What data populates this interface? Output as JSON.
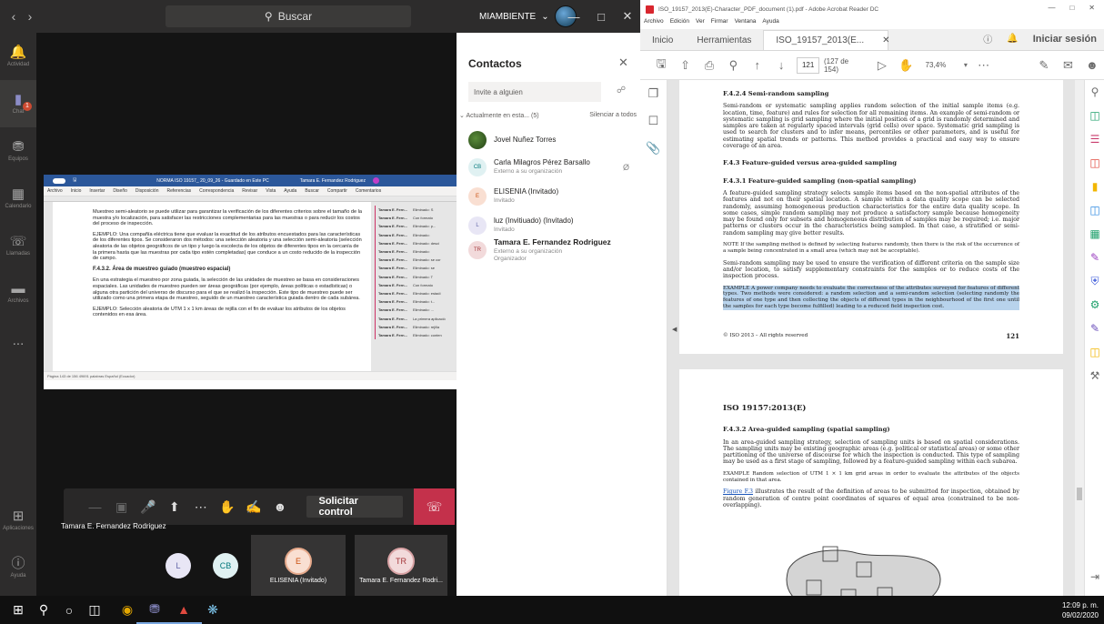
{
  "teams": {
    "search_placeholder": "Buscar",
    "user_label": "MIAMBIENTE",
    "rail": [
      {
        "label": "Actividad",
        "icon": "bell-icon"
      },
      {
        "label": "Chat",
        "icon": "chat-icon",
        "badge": "1"
      },
      {
        "label": "Equipos",
        "icon": "teams-icon"
      },
      {
        "label": "Calendario",
        "icon": "calendar-icon"
      },
      {
        "label": "Llamadas",
        "icon": "phone-icon"
      },
      {
        "label": "Archivos",
        "icon": "files-icon"
      },
      {
        "label": "...",
        "icon": "more-icon"
      }
    ],
    "rail_bottom": [
      {
        "label": "Aplicaciones",
        "icon": "apps-icon"
      },
      {
        "label": "Ayuda",
        "icon": "help-icon"
      }
    ],
    "word": {
      "title": "NORMA ISO 19157_ 20_09_26 - Guardado en Este PC",
      "user": "Tamara E. Fernandez Rodriguez",
      "menu": [
        "Archivo",
        "Inicio",
        "Insertar",
        "Diseño",
        "Disposición",
        "Referencias",
        "Correspondencia",
        "Revisar",
        "Vista",
        "Ayuda",
        "Buscar",
        "Compartir",
        "Comentarios"
      ],
      "paragraphs": [
        "Muestreo semi-aleatorio se puede utilizar para garantizar la verificación de los diferentes criterios sobre el tamaño de la muestra y/o localización, para satisfacer las restricciones complementarias para las muestras o para reducir los costos del proceso de inspección.",
        "EJEMPLO: Una compañía eléctrica tiene que evaluar la exactitud de los atributos encuestados para las características de los diferentes tipos. Se consideraron dos métodos: una selección aleatoria y una selección semi-aleatoria (selección aleatoria de las objetos geográficos de un tipo y luego la escolecta de los objetos de diferentes tipos en la cercanía de la primera hasta que las muestras por cada tipo estén completadas) que conduce a un costo reducido de la inspección de campo."
      ],
      "heading": "F.4.3.2. Área de muestreo guiado (muestreo espacial)",
      "paragraphs2": [
        "En una estrategia el muestreo por zona guiada, la selección de las unidades de muestreo se basa en consideraciones espaciales. Las unidades de muestreo pueden ser áreas geográficas (por ejemplo, áreas políticas o estadísticas) o alguna otra partición del universo de discurso para el que se realizó la inspección. Este tipo de muestreo puede ser utilizado como una primera etapa de muestreo, seguido de un muestreo característica guiada dentro de cada subárea.",
        "EJEMPLO: Selección aleatoria de UTM 1 x 1 km áreas de rejilla con el fin de evaluar los atributos de los objetos contenidos en esa área."
      ],
      "comments": [
        {
          "who": "Tamara E. Fern...",
          "what": "Eliminado: S"
        },
        {
          "who": "Tamara E. Fern...",
          "what": "Con formato"
        },
        {
          "who": "Tamara E. Fern...",
          "what": "Eliminado: p..."
        },
        {
          "who": "Tamara E. Fern...",
          "what": "Eliminado:"
        },
        {
          "who": "Tamara E. Fern...",
          "what": "Eliminado: desci"
        },
        {
          "who": "Tamara E. Fern...",
          "what": "Eliminado:"
        },
        {
          "who": "Tamara E. Fern...",
          "what": "Eliminado: se cor"
        },
        {
          "who": "Tamara E. Fern...",
          "what": "Eliminado: se"
        },
        {
          "who": "Tamara E. Fern...",
          "what": "Eliminado: T"
        },
        {
          "who": "Tamara E. Fern...",
          "what": "Con formato"
        },
        {
          "who": "Tamara E. Fern...",
          "what": "Eliminado: estadí"
        },
        {
          "who": "Tamara E. Fern...",
          "what": "Eliminado: t..."
        },
        {
          "who": "Tamara E. Fern...",
          "what": "Eliminado: ..."
        },
        {
          "who": "Tamara E. Fern...",
          "what": "La primera aplicació"
        },
        {
          "who": "Tamara E. Fern...",
          "what": "Eliminado: rejilla"
        },
        {
          "who": "Tamara E. Fern...",
          "what": "Eliminado: conten"
        }
      ],
      "status": "Página 143 de 156   49691 palabras   Español (Ecuador)"
    },
    "call": {
      "request_control": "Solicitar control",
      "presenter": "Tamara E. Fernandez Rodriguez"
    },
    "participants": [
      {
        "initials": "L",
        "color": "#e8e6f5"
      },
      {
        "initials": "CB",
        "color": "#e0f1f2"
      }
    ],
    "tiles": [
      {
        "initials": "E",
        "name": "ELISENIA (Invitado)",
        "color": "#f9dfd2"
      },
      {
        "initials": "TR",
        "name": "Tamara E. Fernandez Rodri...",
        "color": "#f2dadb"
      }
    ],
    "contacts": {
      "title": "Contactos",
      "invite_placeholder": "Invite a alguien",
      "section": "Actualmente en esta... (5)",
      "mute_all": "Silenciar a todos",
      "list": [
        {
          "initials": "",
          "name": "Jovel Nuñez Torres",
          "sub": "",
          "color": "photo"
        },
        {
          "initials": "CB",
          "name": "Carla Milagros Pérez Barsallo",
          "sub": "Externo a su organización",
          "color": "#e0f1f2"
        },
        {
          "initials": "E",
          "name": "ELISENIA (Invitado)",
          "sub": "Invitado",
          "color": "#f9dfd2"
        },
        {
          "initials": "L",
          "name": "luz (Invitiuado) (Invitado)",
          "sub": "Invitado",
          "color": "#e8e6f5"
        },
        {
          "initials": "TR",
          "name": "Tamara E. Fernandez Rodriguez",
          "sub": "Externo a su organización\nOrganizador",
          "color": "#f2dadb"
        }
      ]
    }
  },
  "acrobat": {
    "window_title": "ISO_19157_2013(E)-Character_PDF_document (1).pdf - Adobe Acrobat Reader DC",
    "menu": [
      "Archivo",
      "Edición",
      "Ver",
      "Firmar",
      "Ventana",
      "Ayuda"
    ],
    "tabs": [
      "Inicio",
      "Herramientas",
      "ISO_19157_2013(E..."
    ],
    "login": "Iniciar sesión",
    "page_number": "121",
    "page_count": "(127 de 154)",
    "zoom": "73,4%",
    "page1": {
      "h1": "F.4.2.4   Semi-random sampling",
      "p1": "Semi-random or systematic sampling applies random selection of the initial sample items (e.g. location, time, feature) and rules for selection for all remaining items. An example of semi-random or systematic sampling is grid sampling where the initial position of a grid is randomly determined and samples are taken at regularly spaced intervals (grid cells) over space. Systematic grid sampling is used to search for clusters and to infer means, percentiles or other parameters, and is useful for estimating spatial trends or patterns. This method provides a practical and easy way to ensure coverage of an area.",
      "h2": "F.4.3   Feature-guided versus area-guided sampling",
      "h3": "F.4.3.1   Feature-guided sampling (non-spatial sampling)",
      "p2": "A feature-guided sampling strategy selects sample items based on the non-spatial attributes of the features and not on their spatial location. A sample within a data quality scope can be selected randomly, assuming homogeneous production characteristics for the entire data quality scope. In some cases, simple random sampling may not produce a satisfactory sample because homogeneity may be found only for subsets and homogeneous distribution of samples may be required; i.e. major patterns or clusters occur in the characteristics being sampled. In that case, a stratified or semi-random sampling may give better results.",
      "note": "NOTE      If the sampling method is defined by selecting features randomly, then there is the risk of the occurrence of a sample being concentrated in a small area (which may not be acceptable).",
      "p3": "Semi-random sampling may be used to ensure the verification of different criteria on the sample size and/or location, to satisfy supplementary constraints for the samples or to reduce costs of the inspection process.",
      "example": "EXAMPLE      A power company needs to evaluate the correctness of the attributes surveyed for features of different types. Two methods were considered: a random selection and a semi-random selection (selecting randomly the features of one type and then collecting the objects of different types in the neighbourhood of the first one until the samples for each type become fulfilled) leading to a reduced field inspection cost.",
      "copyright": "© ISO 2013 – All rights reserved",
      "number": "121"
    },
    "page2": {
      "header": "ISO 19157:2013(E)",
      "h1": "F.4.3.2   Area-guided sampling (spatial sampling)",
      "p1": "In an area-guided sampling strategy, selection of sampling units is based on spatial considerations. The sampling units may be existing geographic areas (e.g. political or statistical areas) or some other partitioning of the universe of discourse for which the inspection is conducted. This type of sampling may be used as a first stage of sampling, followed by a feature-guided sampling within each subarea.",
      "example": "EXAMPLE      Random selection of UTM 1 × 1 km grid areas in order to evaluate the attributes of the objects contained in that area.",
      "fig_link": "Figure F.3",
      "p2": " illustrates the result of the definition of areas to be submitted for inspection, obtained by random generation of centre point coordinates of squares of equal area (constrained to be non-overlapping)."
    },
    "right_tools": [
      {
        "icon": "zoom-search-icon",
        "color": "#6d6d6d"
      },
      {
        "icon": "export-pdf-icon",
        "color": "#1ea06b"
      },
      {
        "icon": "organize-pages-icon",
        "color": "#c93b6c"
      },
      {
        "icon": "create-pdf-icon",
        "color": "#e04a3f"
      },
      {
        "icon": "comment-icon",
        "color": "#f2b600"
      },
      {
        "icon": "combine-files-icon",
        "color": "#2f8ae0"
      },
      {
        "icon": "spreadsheet-icon",
        "color": "#1ea06b"
      },
      {
        "icon": "fill-sign-icon",
        "color": "#9a3fc0"
      },
      {
        "icon": "protect-icon",
        "color": "#3d5bd9"
      },
      {
        "icon": "optimize-icon",
        "color": "#1ea06b"
      },
      {
        "icon": "sign-icon",
        "color": "#6b4fbb"
      },
      {
        "icon": "send-review-icon",
        "color": "#f2b600"
      },
      {
        "icon": "more-tools-icon",
        "color": "#6d6d6d"
      }
    ]
  },
  "taskbar": {
    "time": "12:09 p. m.",
    "date": "09/02/2020"
  }
}
